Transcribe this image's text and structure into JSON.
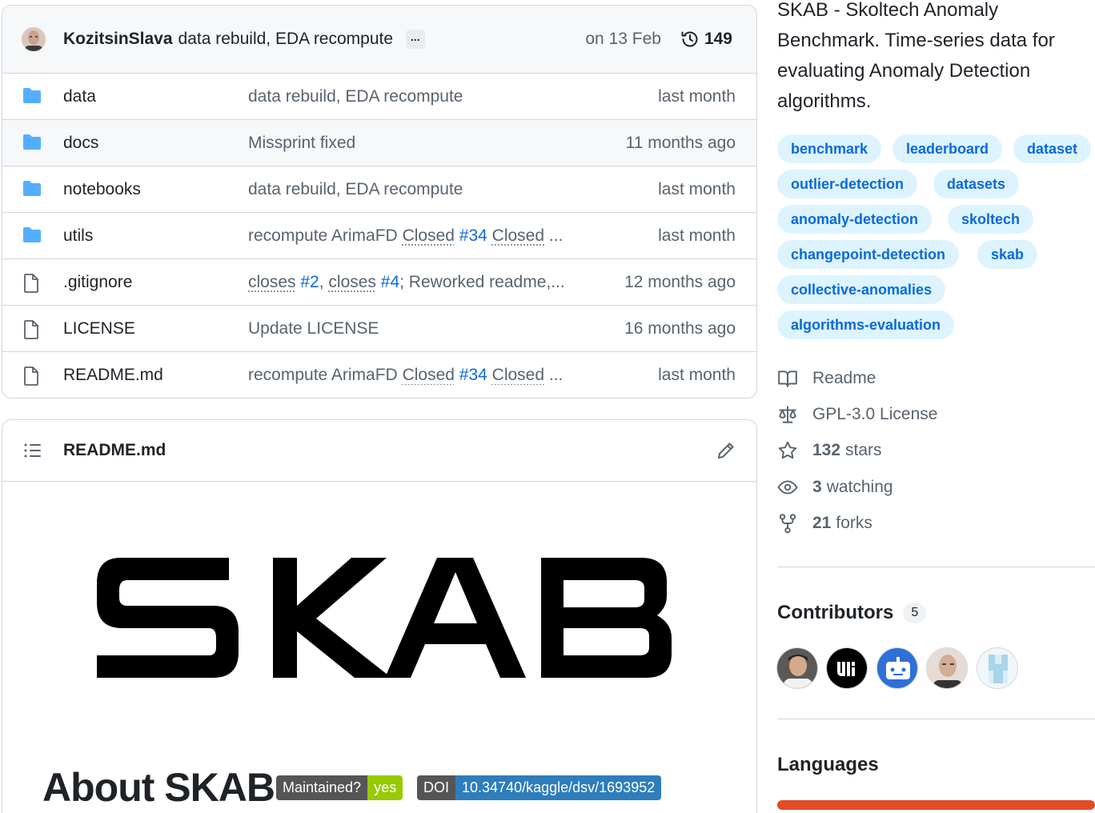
{
  "commit": {
    "author": "KozitsinSlava",
    "message": "data rebuild, EDA recompute",
    "more": "...",
    "date": "on 13 Feb",
    "history_count": "149"
  },
  "files": [
    {
      "name": "data",
      "type": "folder",
      "msg": [
        {
          "t": "data rebuild, EDA recompute"
        }
      ],
      "date": "last month"
    },
    {
      "name": "docs",
      "type": "folder",
      "msg": [
        {
          "t": "Missprint fixed"
        }
      ],
      "date": "11 months ago"
    },
    {
      "name": "notebooks",
      "type": "folder",
      "msg": [
        {
          "t": "data rebuild, EDA recompute"
        }
      ],
      "date": "last month"
    },
    {
      "name": "utils",
      "type": "folder",
      "msg": [
        {
          "t": "recompute ArimaFD "
        },
        {
          "t": "Closed",
          "k": "dot"
        },
        {
          "t": " "
        },
        {
          "t": "#34",
          "k": "link"
        },
        {
          "t": " "
        },
        {
          "t": "Closed",
          "k": "dot"
        },
        {
          "t": " ..."
        }
      ],
      "date": "last month"
    },
    {
      "name": ".gitignore",
      "type": "file",
      "msg": [
        {
          "t": "closes",
          "k": "dot"
        },
        {
          "t": " "
        },
        {
          "t": "#2",
          "k": "link"
        },
        {
          "t": ", "
        },
        {
          "t": "closes",
          "k": "dot"
        },
        {
          "t": " "
        },
        {
          "t": "#4",
          "k": "link"
        },
        {
          "t": "; Reworked readme,..."
        }
      ],
      "date": "12 months ago"
    },
    {
      "name": "LICENSE",
      "type": "file",
      "msg": [
        {
          "t": "Update LICENSE"
        }
      ],
      "date": "16 months ago"
    },
    {
      "name": "README.md",
      "type": "file",
      "msg": [
        {
          "t": "recompute ArimaFD "
        },
        {
          "t": "Closed",
          "k": "dot"
        },
        {
          "t": " "
        },
        {
          "t": "#34",
          "k": "link"
        },
        {
          "t": " "
        },
        {
          "t": "Closed",
          "k": "dot"
        },
        {
          "t": " ..."
        }
      ],
      "date": "last month"
    }
  ],
  "readme": {
    "filename": "README.md",
    "logo_text": "SKAB",
    "heading": "About SKAB",
    "badges": {
      "maintained_label": "Maintained?",
      "maintained_value": "yes",
      "doi_label": "DOI",
      "doi_value": "10.34740/kaggle/dsv/1693952"
    }
  },
  "sidebar": {
    "description": "SKAB - Skoltech Anomaly Benchmark. Time-series data for evaluating Anomaly Detection algorithms.",
    "topics": [
      "benchmark",
      "leaderboard",
      "dataset",
      "outlier-detection",
      "datasets",
      "anomaly-detection",
      "skoltech",
      "changepoint-detection",
      "skab",
      "collective-anomalies",
      "algorithms-evaluation"
    ],
    "readme_link": "Readme",
    "license": "GPL-3.0 License",
    "stars_count": "132",
    "stars_label": "stars",
    "watching_count": "3",
    "watching_label": "watching",
    "forks_count": "21",
    "forks_label": "forks",
    "contributors_title": "Contributors",
    "contributors_count": "5",
    "languages_title": "Languages"
  },
  "colors": {
    "link": "#0969da",
    "topic_bg": "#ddf4ff",
    "language_bar": "#e34c26"
  }
}
